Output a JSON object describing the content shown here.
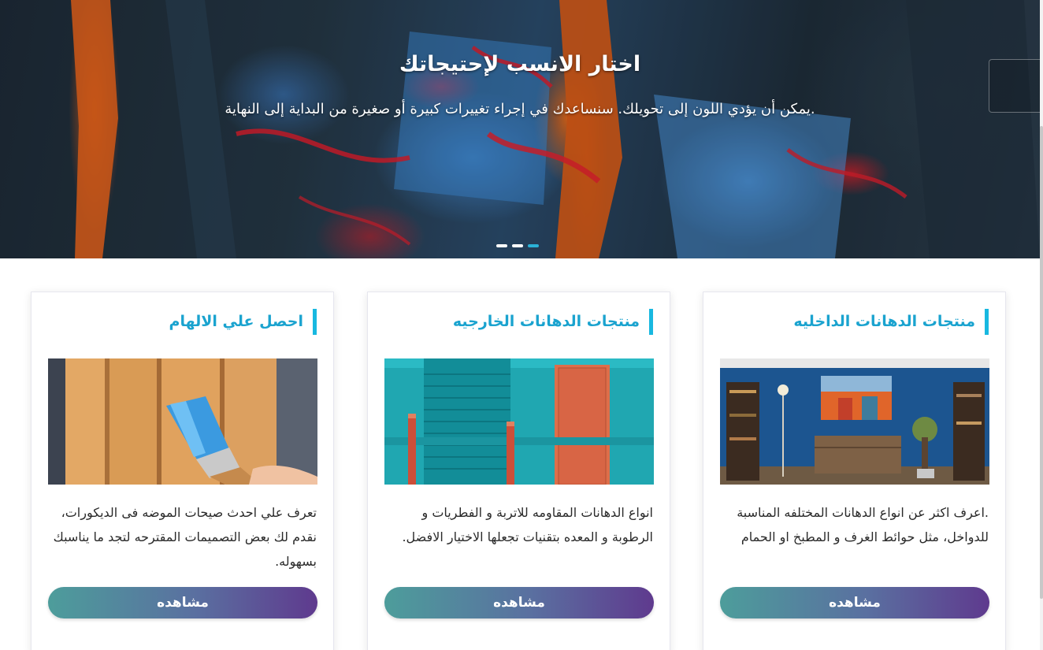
{
  "hero": {
    "title": "اختار الانسب لإحتيجاتك",
    "subtitle": "يمكن أن يؤدي اللون إلى تحويلك. سنساعدك في إجراء تغييرات كبيرة أو صغيرة من البداية إلى النهاية.",
    "slides_count": 3,
    "active_slide": 3
  },
  "colors": {
    "accent": "#18b8e0",
    "button_gradient_start": "#5f3a8e",
    "button_gradient_end": "#4d9d9b"
  },
  "cards": [
    {
      "title": "منتجات الدهانات الداخليه",
      "image": "blue-living-room-photo",
      "text": ".اعرف اكثر عن انواع الدهانات المختلفه المناسبة للدواخل، مثل حوائط الغرف و المطبخ او الحمام",
      "button_label": "مشاهده"
    },
    {
      "title": "منتجات الدهانات الخارجيه",
      "image": "teal-building-facade-photo",
      "text": "انواع الدهانات المقاومه للاتربة و الفطريات و الرطوبة و المعده بتقنيات تجعلها الاختيار الافضل.",
      "button_label": "مشاهده"
    },
    {
      "title": "احصل علي الالهام",
      "image": "paint-brush-on-wood-photo",
      "text": "تعرف علي احدث صيحات الموضه فى الديكورات، نقدم لك بعض التصميمات المقترحه لتجد ما يناسبك بسهوله.",
      "button_label": "مشاهده"
    }
  ]
}
